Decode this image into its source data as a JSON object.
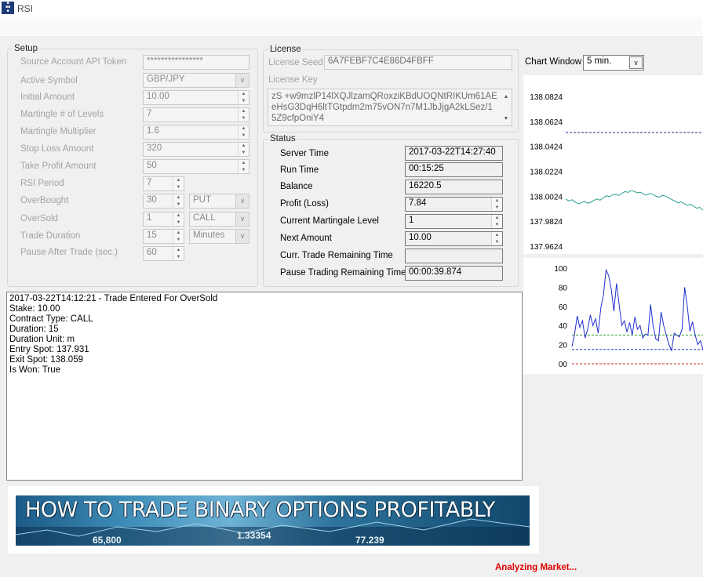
{
  "window": {
    "title": "RSI",
    "icon": "app-logo-icon"
  },
  "setup": {
    "legend": "Setup",
    "rows": [
      {
        "label": "Source Account API Token",
        "value": "****************"
      },
      {
        "label": "Active Symbol",
        "value": "GBP/JPY"
      },
      {
        "label": "Initial Amount",
        "value": "10.00"
      },
      {
        "label": "Martingle # of Levels",
        "value": "7"
      },
      {
        "label": "Martingle Multiplier",
        "value": "1.6"
      },
      {
        "label": "Stop Loss Amount",
        "value": "320"
      },
      {
        "label": "Take Profit Amount",
        "value": "50"
      },
      {
        "label": "RSI Period",
        "value": "7"
      },
      {
        "label": "OverBought",
        "value": "30",
        "option": "PUT"
      },
      {
        "label": "OverSold",
        "value": "1",
        "option": "CALL"
      },
      {
        "label": "Trade Duration",
        "value": "15",
        "option": "Minutes"
      },
      {
        "label": "Pause After Trade (sec.)",
        "value": "60"
      }
    ]
  },
  "license": {
    "legend": "License",
    "seed_label": "License Seed",
    "seed_value": "6A7FEBF7C4E86D4FBFF",
    "key_label": "License Key",
    "key_value": "zS +w9mzlP14lXQJlzamQRoxziKBdUOQNtRIKUm61AEeHsG3DqH6ltTGtpdm2m75vON7n7M1JbJjgA2kLSez/15Z9cfpOniY4"
  },
  "status": {
    "legend": "Status",
    "rows": [
      {
        "label": "Server Time",
        "value": "2017-03-22T14:27:40"
      },
      {
        "label": "Run Time",
        "value": "00:15:25"
      },
      {
        "label": "Balance",
        "value": "16220.5"
      },
      {
        "label": "Profit (Loss)",
        "value": "7.84"
      },
      {
        "label": "Current Martingale Level",
        "value": "1"
      },
      {
        "label": "Next Amount",
        "value": "10.00"
      },
      {
        "label": "Curr. Trade Remaining Time",
        "value": ""
      },
      {
        "label": "Pause Trading Remaining Time",
        "value": "00:00:39.874"
      }
    ]
  },
  "chart_window": {
    "label": "Chart Window",
    "value": "5 min."
  },
  "log": {
    "lines": [
      "2017-03-22T14:12:21 - Trade Entered For OverSold",
      "Stake: 10.00",
      "Contract Type: CALL",
      "Duration: 15",
      "Duration Unit: m",
      "Entry Spot: 137.931",
      "Exit Spot: 138.059",
      "Is Won: True"
    ]
  },
  "banner": {
    "text": "HOW TO TRADE BINARY OPTIONS PROFITABLY",
    "numbers": [
      "65,800",
      "1.33354",
      "77.239"
    ]
  },
  "status_bar": {
    "text": "Analyzing Market...",
    "color": "#e00000"
  },
  "chart_data": [
    {
      "type": "line",
      "title": "",
      "y_ticks": [
        "138.0824",
        "138.0624",
        "138.0424",
        "138.0224",
        "138.0024",
        "137.9824",
        "137.9624"
      ],
      "ylim": [
        137.9624,
        138.0824
      ],
      "reference_line": 138.0534,
      "series": [
        {
          "color": "#2a9d8f",
          "values": [
            138.0001,
            137.9987,
            137.9996,
            137.9978,
            137.9964,
            137.9971,
            137.9983,
            137.9968,
            137.9975,
            137.999,
            138.0002,
            137.9993,
            138.001,
            138.0028,
            138.002,
            138.0035,
            138.0042,
            138.003,
            138.0048,
            138.0061,
            138.0055,
            138.007,
            138.0062,
            138.0051,
            138.0057,
            138.004,
            138.0033,
            138.0046,
            138.0039,
            138.0023,
            138.0016,
            138.0031,
            138.0025,
            138.0012,
            137.9998,
            137.9986,
            137.9971,
            137.998,
            137.9963,
            137.9952,
            137.9961,
            137.9944,
            137.9928,
            137.9935,
            137.9912
          ]
        }
      ]
    },
    {
      "type": "line",
      "title": "",
      "y_ticks": [
        "100",
        "80",
        "60",
        "40",
        "20",
        "00"
      ],
      "ylim": [
        0,
        100
      ],
      "reference_lines": [
        {
          "value": 30,
          "color": "#33a02c"
        },
        {
          "value": 15,
          "color": "#1f3fbf"
        },
        {
          "value": 0,
          "color": "#cc2222"
        }
      ],
      "series": [
        {
          "color": "#1f2fd0",
          "values": [
            18,
            31,
            50,
            38,
            45,
            27,
            36,
            51,
            40,
            47,
            32,
            58,
            72,
            98,
            92,
            78,
            55,
            84,
            62,
            40,
            45,
            33,
            43,
            30,
            49,
            36,
            40,
            27,
            31,
            30,
            62,
            39,
            26,
            24,
            54,
            40,
            30,
            20,
            14,
            32,
            30,
            28,
            36,
            80,
            60,
            34,
            44,
            30,
            20,
            24,
            15
          ]
        }
      ]
    }
  ]
}
